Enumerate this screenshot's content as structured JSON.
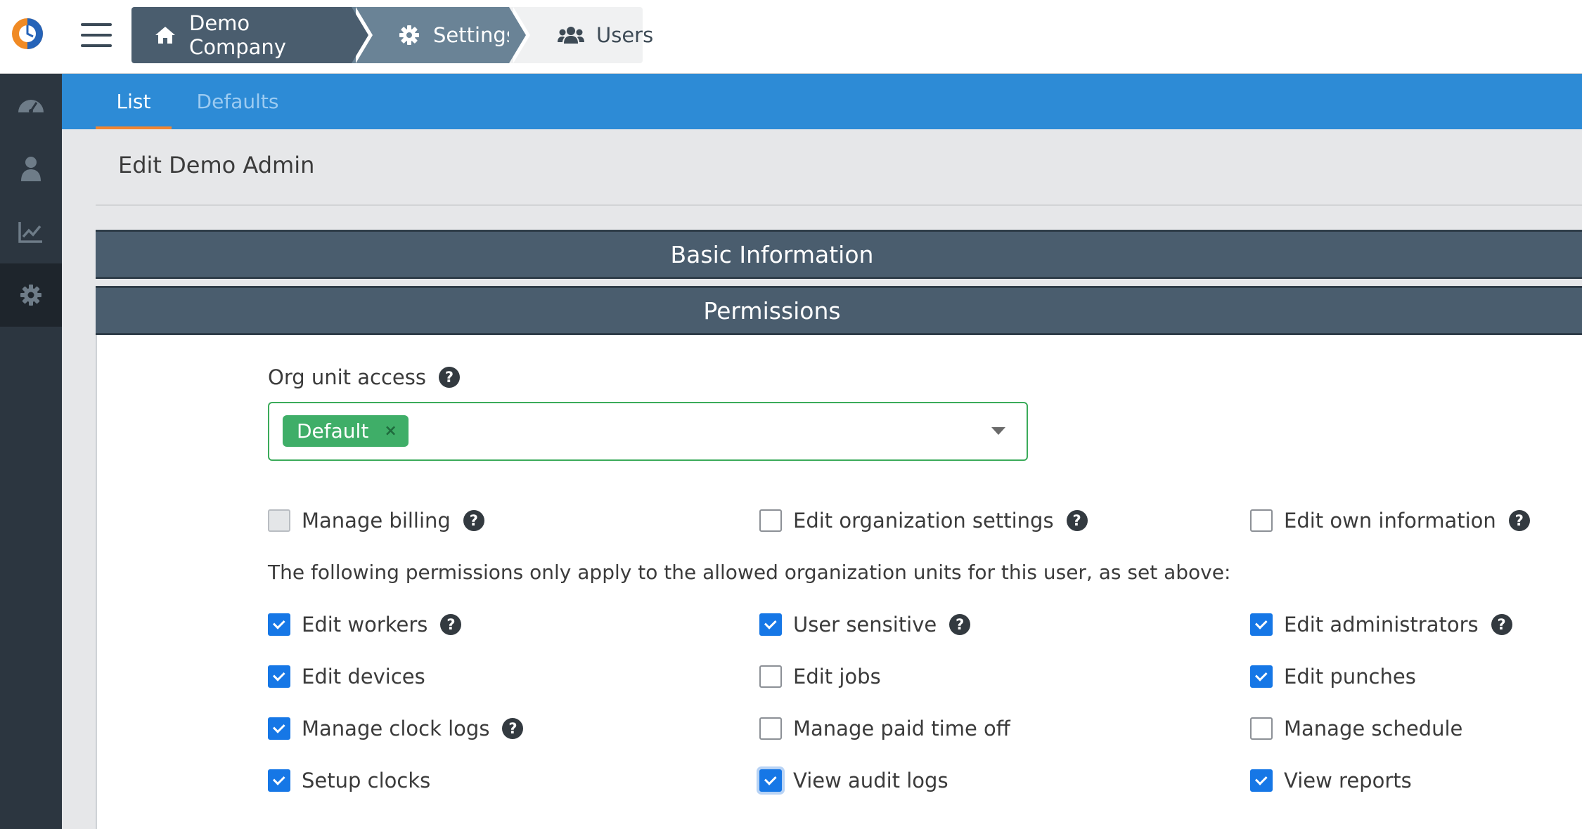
{
  "app": {
    "logo": "app-logo"
  },
  "breadcrumb": [
    {
      "label": "Demo Company",
      "icon": "home-icon"
    },
    {
      "label": "Settings",
      "icon": "gear-icon"
    },
    {
      "label": "Users",
      "icon": "users-icon"
    }
  ],
  "sidebar": {
    "items": [
      {
        "icon": "dashboard-icon",
        "active": false
      },
      {
        "icon": "worker-icon",
        "active": false
      },
      {
        "icon": "chart-icon",
        "active": false
      },
      {
        "icon": "gear-icon",
        "active": true
      }
    ]
  },
  "tabs": [
    {
      "label": "List",
      "active": true
    },
    {
      "label": "Defaults",
      "active": false
    }
  ],
  "page": {
    "title": "Edit Demo Admin"
  },
  "sections": {
    "basic": "Basic Information",
    "permissions": "Permissions"
  },
  "org_unit": {
    "label": "Org unit access",
    "help": "?",
    "selected_tag": "Default",
    "remove_glyph": "×"
  },
  "note": "The following permissions only apply to the allowed organization units for this user, as set above:",
  "global_permissions": [
    {
      "label": "Manage billing",
      "checked": false,
      "disabled": true,
      "help": "?"
    },
    {
      "label": "Edit organization settings",
      "checked": false,
      "help": "?"
    },
    {
      "label": "Edit own information",
      "checked": false,
      "help": "?"
    }
  ],
  "unit_permissions": [
    {
      "label": "Edit workers",
      "checked": true,
      "help": "?"
    },
    {
      "label": "User sensitive",
      "checked": true,
      "help": "?"
    },
    {
      "label": "Edit administrators",
      "checked": true,
      "help": "?"
    },
    {
      "label": "Edit devices",
      "checked": true
    },
    {
      "label": "Edit jobs",
      "checked": false
    },
    {
      "label": "Edit punches",
      "checked": true
    },
    {
      "label": "Manage clock logs",
      "checked": true,
      "help": "?"
    },
    {
      "label": "Manage paid time off",
      "checked": false
    },
    {
      "label": "Manage schedule",
      "checked": false
    },
    {
      "label": "Setup clocks",
      "checked": true
    },
    {
      "label": "View audit logs",
      "checked": true,
      "focused": true
    },
    {
      "label": "View reports",
      "checked": true
    }
  ],
  "colors": {
    "header_dark": "#4a5d6e",
    "crumb_mid": "#6a8396",
    "tabbar": "#2d8bd6",
    "tab_underline": "#f2852f",
    "sidebar": "#2c3640",
    "checkbox_checked": "#1677e6",
    "tag_green": "#3fae68"
  }
}
